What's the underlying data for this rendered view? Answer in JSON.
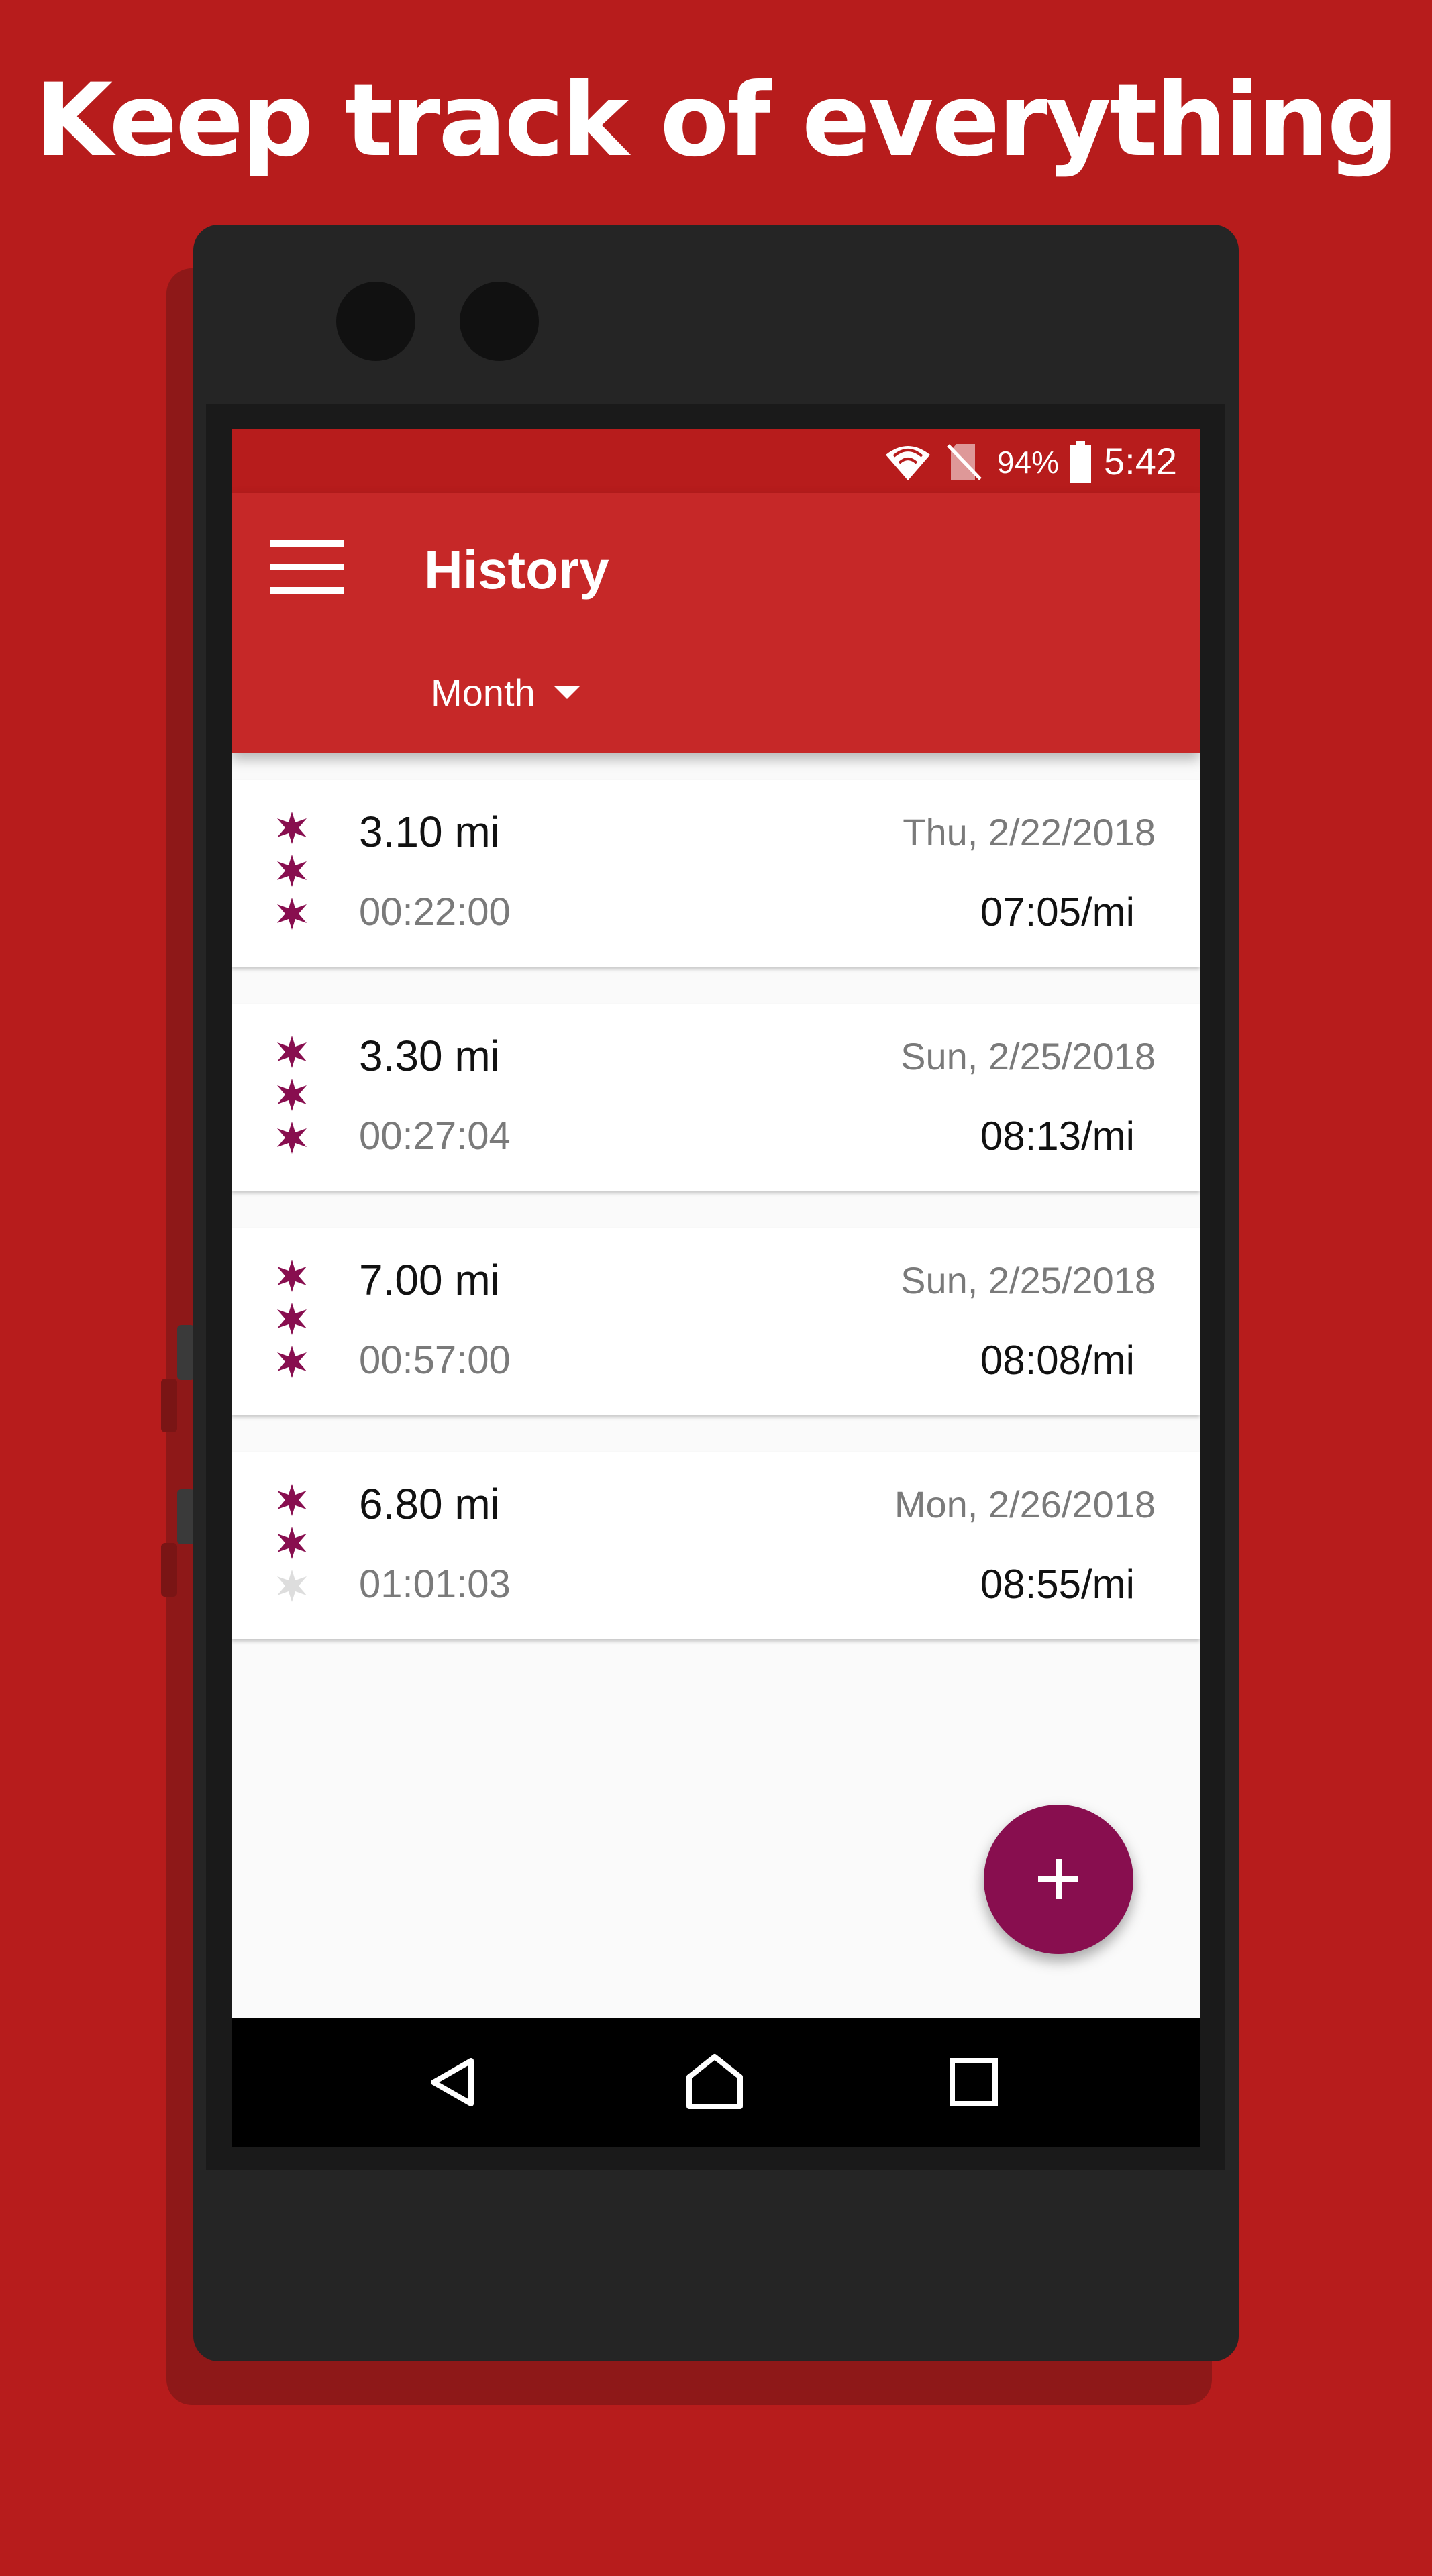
{
  "promo": {
    "headline": "Keep track of everything"
  },
  "statusbar": {
    "battery_percent": "94%",
    "time": "5:42",
    "icons": [
      "wifi-icon",
      "no-sim-icon",
      "battery-icon"
    ]
  },
  "appbar": {
    "title": "History",
    "filter_label": "Month",
    "icons": [
      "menu-icon",
      "dropdown-caret-icon"
    ]
  },
  "runs": [
    {
      "distance": "3.10 mi",
      "duration": "00:22:00",
      "date": "Thu, 2/22/2018",
      "pace": "07:05/mi",
      "rating": 3
    },
    {
      "distance": "3.30 mi",
      "duration": "00:27:04",
      "date": "Sun, 2/25/2018",
      "pace": "08:13/mi",
      "rating": 3
    },
    {
      "distance": "7.00 mi",
      "duration": "00:57:00",
      "date": "Sun, 2/25/2018",
      "pace": "08:08/mi",
      "rating": 3
    },
    {
      "distance": "6.80 mi",
      "duration": "01:01:03",
      "date": "Mon, 2/26/2018",
      "pace": "08:55/mi",
      "rating": 2
    }
  ],
  "fab": {
    "icon": "add-icon"
  },
  "navbar": {
    "icons": [
      "back-icon",
      "home-icon",
      "recents-icon"
    ]
  },
  "colors": {
    "background": "#b71c1c",
    "appbar": "#c62828",
    "statusbar": "#b71c1c",
    "accent": "#880e4f",
    "star_filled": "#880e4f",
    "star_empty": "#dddddd"
  }
}
